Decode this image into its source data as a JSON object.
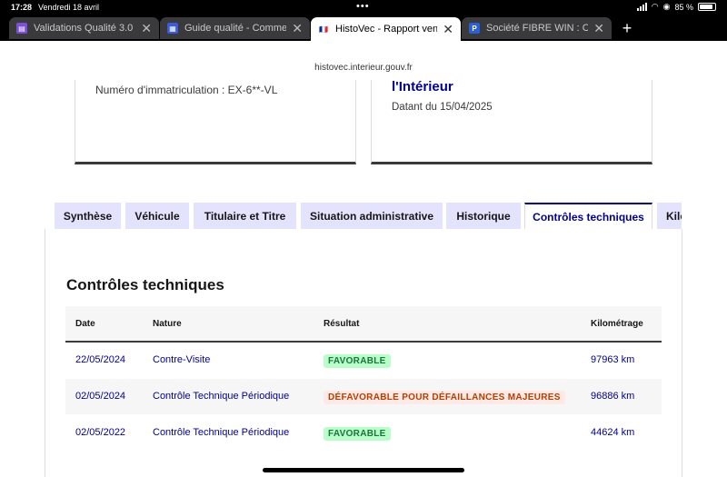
{
  "status": {
    "time": "17:28",
    "date": "Vendredi 18 avril",
    "battery": "85 %"
  },
  "browser": {
    "tabs": [
      {
        "label": "Validations Qualité 3.0",
        "favicon_color": "#7b4fd6",
        "favicon_glyph": "▤"
      },
      {
        "label": "Guide qualité - Commentaires",
        "favicon_color": "#3b5bdb",
        "favicon_glyph": "▦"
      },
      {
        "label": "HistoVec - Rapport vendeur",
        "favicon_color": "#ffffff",
        "favicon_glyph": "🇫🇷",
        "active": true
      },
      {
        "label": "Société FIBRE WIN : Chiffre",
        "favicon_color": "#2c5fd6",
        "favicon_glyph": "P"
      }
    ],
    "url": "histovec.interieur.gouv.fr"
  },
  "cards": {
    "immat": "Numéro d'immatriculation : EX-6**-VL",
    "ministry": "l'Intérieur",
    "dated": "Datant du 15/04/2025"
  },
  "nav": {
    "tabs": [
      "Synthèse",
      "Véhicule",
      "Titulaire et Titre",
      "Situation administrative",
      "Historique",
      "Contrôles techniques",
      "Kilométrage"
    ],
    "active": "Contrôles techniques"
  },
  "section_title": "Contrôles techniques",
  "table": {
    "headers": [
      "Date",
      "Nature",
      "Résultat",
      "Kilométrage"
    ],
    "rows": [
      {
        "date": "22/05/2024",
        "nature": "Contre-Visite",
        "result": "FAVORABLE",
        "status": "ok",
        "km": "97963 km"
      },
      {
        "date": "02/05/2024",
        "nature": "Contrôle Technique Périodique",
        "result": "DÉFAVORABLE POUR DÉFAILLANCES MAJEURES",
        "status": "ko",
        "km": "96886 km"
      },
      {
        "date": "02/05/2022",
        "nature": "Contrôle Technique Périodique",
        "result": "FAVORABLE",
        "status": "ok",
        "km": "44624 km"
      }
    ]
  }
}
